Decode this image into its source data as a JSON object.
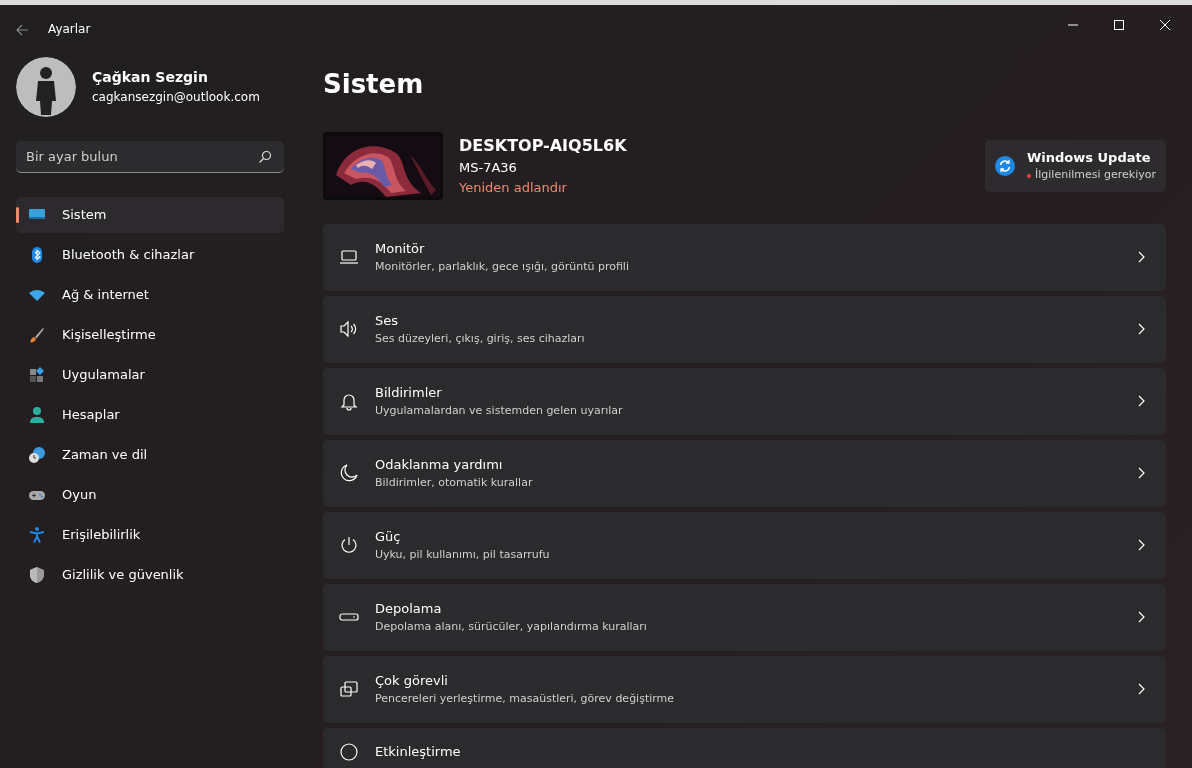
{
  "window": {
    "title": "Ayarlar"
  },
  "user": {
    "name": "Çağkan Sezgin",
    "email": "cagkansezgin@outlook.com"
  },
  "search": {
    "placeholder": "Bir ayar bulun"
  },
  "sidebar": {
    "items": [
      {
        "label": "Sistem",
        "selected": true
      },
      {
        "label": "Bluetooth & cihazlar",
        "selected": false
      },
      {
        "label": "Ağ & internet",
        "selected": false
      },
      {
        "label": "Kişiselleştirme",
        "selected": false
      },
      {
        "label": "Uygulamalar",
        "selected": false
      },
      {
        "label": "Hesaplar",
        "selected": false
      },
      {
        "label": "Zaman ve dil",
        "selected": false
      },
      {
        "label": "Oyun",
        "selected": false
      },
      {
        "label": "Erişilebilirlik",
        "selected": false
      },
      {
        "label": "Gizlilik ve güvenlik",
        "selected": false
      }
    ]
  },
  "page_title": "Sistem",
  "device": {
    "name": "DESKTOP-AIQ5L6K",
    "model": "MS-7A36",
    "rename_link": "Yeniden adlandır"
  },
  "update": {
    "title": "Windows Update",
    "status": "İlgilenilmesi gerekiyor"
  },
  "settings": [
    {
      "title": "Monitör",
      "subtitle": "Monitörler, parlaklık, gece ışığı, görüntü profili"
    },
    {
      "title": "Ses",
      "subtitle": "Ses düzeyleri, çıkış, giriş, ses cihazları"
    },
    {
      "title": "Bildirimler",
      "subtitle": "Uygulamalardan ve sistemden gelen uyarılar"
    },
    {
      "title": "Odaklanma yardımı",
      "subtitle": "Bildirimler, otomatik kurallar"
    },
    {
      "title": "Güç",
      "subtitle": "Uyku, pil kullanımı, pil tasarrufu"
    },
    {
      "title": "Depolama",
      "subtitle": "Depolama alanı, sürücüler, yapılandırma kuralları"
    },
    {
      "title": "Çok görevli",
      "subtitle": "Pencereleri yerleştirme, masaüstleri, görev değiştirme"
    },
    {
      "title": "Etkinleştirme"
    }
  ]
}
